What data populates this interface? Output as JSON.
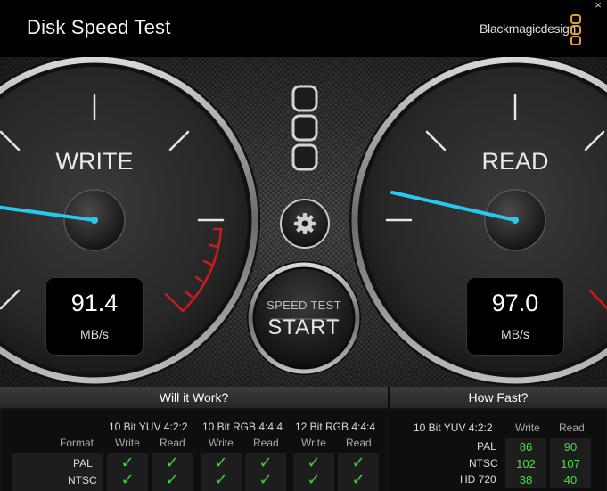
{
  "window": {
    "title": "Disk Speed Test",
    "brand": "Blackmagicdesign",
    "close_glyph": "×"
  },
  "gauges": {
    "write": {
      "label": "WRITE",
      "value": "91.4",
      "unit": "MB/s"
    },
    "read": {
      "label": "READ",
      "value": "97.0",
      "unit": "MB/s"
    }
  },
  "start_button": {
    "line1": "SPEED TEST",
    "line2": "START"
  },
  "icons": {
    "settings": "gear-icon",
    "stress_indicator": "three-rounded-squares-icon"
  },
  "colors": {
    "needle": "#29c8ee",
    "redline": "#d01a1a",
    "check": "#3bd23b",
    "value_green": "#45e045"
  },
  "will_it_work": {
    "header": "Will it Work?",
    "format_label": "Format",
    "groups": [
      {
        "name": "10 Bit YUV 4:2:2",
        "write": "Write",
        "read": "Read"
      },
      {
        "name": "10 Bit RGB 4:4:4",
        "write": "Write",
        "read": "Read"
      },
      {
        "name": "12 Bit RGB 4:4:4",
        "write": "Write",
        "read": "Read"
      }
    ],
    "rows": [
      {
        "format": "PAL",
        "checks": [
          "✓",
          "✓",
          "✓",
          "✓",
          "✓",
          "✓"
        ]
      },
      {
        "format": "NTSC",
        "checks": [
          "✓",
          "✓",
          "✓",
          "✓",
          "✓",
          "✓"
        ]
      }
    ]
  },
  "how_fast": {
    "header": "How Fast?",
    "group": "10 Bit YUV 4:2:2",
    "write": "Write",
    "read": "Read",
    "rows": [
      {
        "format": "PAL",
        "write": "86",
        "read": "90"
      },
      {
        "format": "NTSC",
        "write": "102",
        "read": "107"
      },
      {
        "format": "HD 720",
        "write": "38",
        "read": "40"
      }
    ]
  }
}
